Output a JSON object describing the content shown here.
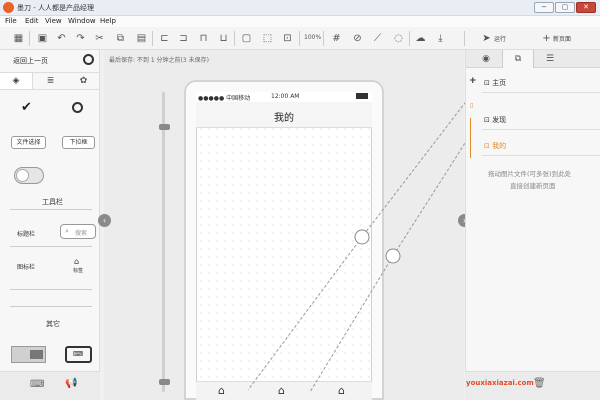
{
  "window": {
    "title": "墨刀 - 人人都是产品经理",
    "controls": [
      "−",
      "▢",
      "✕"
    ]
  },
  "menu": [
    "File",
    "Edit",
    "View",
    "Window",
    "Help"
  ],
  "toolbar": {
    "zoom": "100%",
    "preview_label": "运行",
    "new_page_label": "新页面"
  },
  "left_panel": {
    "back_label": "返回上一页",
    "file_select_label": "文件选择",
    "dropdown_label": "下拉框",
    "section_toolbar": "工具栏",
    "titlebar_label": "标题栏",
    "search_label": "搜索",
    "tabbar_label": "图标栏",
    "tabbar_item_label": "标签",
    "section_other": "其它"
  },
  "canvas": {
    "save_info": "最后保存: 不到 1 分钟之前(3 未保存)",
    "phone": {
      "signal": "●●●●● 中国移动",
      "time": "12:00 AM",
      "title": "我的"
    }
  },
  "right_panel": {
    "pages": [
      {
        "label": "主页",
        "color": "#333333"
      },
      {
        "label": "发现",
        "color": "#333333"
      },
      {
        "label": "我的",
        "color": "#e08a2a"
      }
    ],
    "hint_line1": "拖动图片文件(可多张)到此处",
    "hint_line2": "直接创建新页面"
  },
  "watermark": "youxiaxiazai.com",
  "colors": {
    "accent": "#e08a2a",
    "logo": "#e8622a",
    "close": "#c8463a"
  }
}
